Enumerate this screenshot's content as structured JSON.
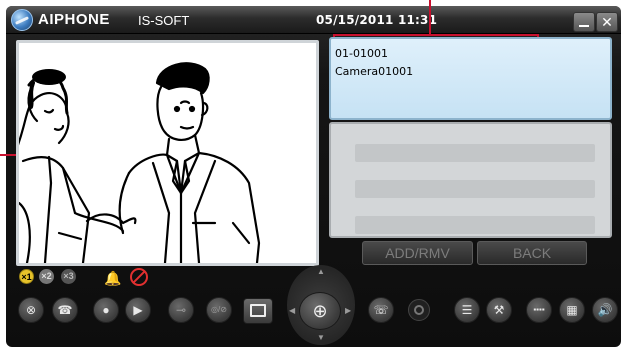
{
  "titlebar": {
    "brand": "AIPHONE",
    "product": "IS-SOFT",
    "datetime": "05/15/2011 11:31"
  },
  "station_info": {
    "id": "01-01001",
    "name": "Camera01001"
  },
  "buttons": {
    "add_remove": "ADD/RMV",
    "back": "BACK"
  },
  "zoom": {
    "levels": [
      "x1",
      "x2",
      "x3"
    ],
    "active": "x1"
  },
  "controls": {
    "camera_off_button_label": "◎/⊘"
  },
  "colors": {
    "annotation": "#c8102e",
    "info_bg": "#d4ebf8",
    "active_zoom": "#e6c22a",
    "bell": "#3fc03f",
    "no_camera": "#e23030"
  },
  "icons": [
    "globe-icon",
    "minimize-icon",
    "close-icon",
    "bell-icon",
    "no-camera-icon",
    "cancel-icon",
    "handset-icon",
    "record-icon",
    "play-icon",
    "door-release-icon",
    "camera-toggle-icon",
    "screen-icon",
    "zoom-icon",
    "page-icon",
    "ring-icon",
    "list-icon",
    "tools-icon",
    "station-icon",
    "grid-icon",
    "volume-icon"
  ]
}
